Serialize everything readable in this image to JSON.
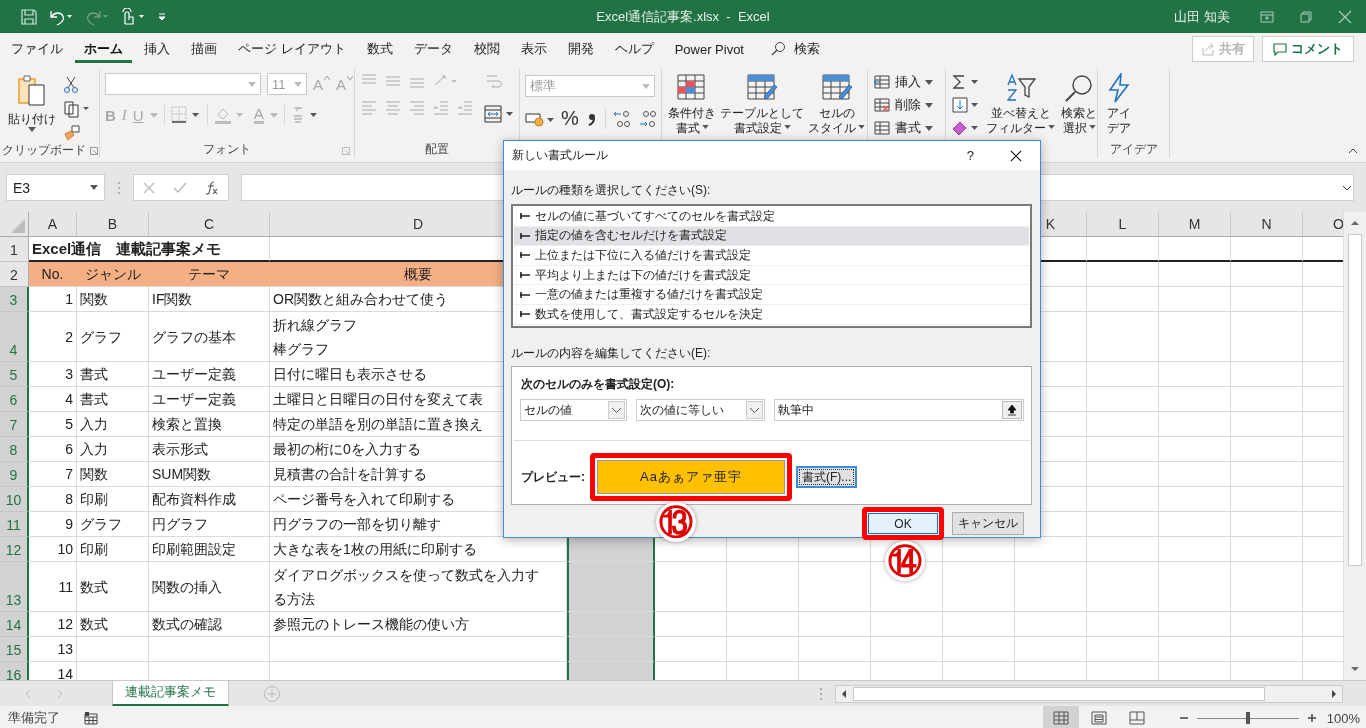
{
  "title_bar": {
    "title": "Excel通信記事案.xlsx  -  Excel",
    "user": "山田 知美"
  },
  "menu_tabs": [
    {
      "label": "ファイル",
      "selected": false
    },
    {
      "label": "ホーム",
      "selected": true
    },
    {
      "label": "挿入",
      "selected": false
    },
    {
      "label": "描画",
      "selected": false
    },
    {
      "label": "ページ レイアウト",
      "selected": false
    },
    {
      "label": "数式",
      "selected": false
    },
    {
      "label": "データ",
      "selected": false
    },
    {
      "label": "校閲",
      "selected": false
    },
    {
      "label": "表示",
      "selected": false
    },
    {
      "label": "開発",
      "selected": false
    },
    {
      "label": "ヘルプ",
      "selected": false
    },
    {
      "label": "Power Pivot",
      "selected": false
    }
  ],
  "search": {
    "label": "検索"
  },
  "share_button": {
    "label": "共有",
    "disabled": true
  },
  "comment_button": {
    "label": "コメント"
  },
  "ribbon": {
    "clipboard": {
      "paste": "貼り付け",
      "group": "クリップボード"
    },
    "font": {
      "size": "11",
      "grow": "A",
      "shrink": "A",
      "bold": "B",
      "italic": "I",
      "underline": "U",
      "font_color": "A",
      "group": "フォント"
    },
    "alignment": {
      "group": "配置"
    },
    "number": {
      "format": "標準",
      "percent": "%"
    },
    "styles": [
      {
        "lines": [
          "条件付き",
          "書式"
        ]
      },
      {
        "lines": [
          "テーブルとして",
          "書式設定"
        ]
      },
      {
        "lines": [
          "セルの",
          "スタイル"
        ]
      }
    ],
    "cells": [
      "挿入",
      "削除",
      "書式"
    ],
    "editing": [
      {
        "lines": [
          "並べ替えと",
          "フィルター"
        ]
      },
      {
        "lines": [
          "検索と",
          "選択"
        ]
      }
    ],
    "ideas": {
      "lines": [
        "アイ",
        "デア"
      ],
      "group": "アイデア"
    }
  },
  "formula_bar": {
    "name_box": "E3"
  },
  "column_headers_left": [
    "A",
    "B",
    "C",
    "D"
  ],
  "column_headers_right": [
    "K",
    "L",
    "M",
    "N",
    "O"
  ],
  "rows": [
    {
      "num": "1",
      "kind": "title",
      "selected": false,
      "cells": [
        "Excel通信　連載記事案メモ"
      ]
    },
    {
      "num": "2",
      "kind": "header",
      "selected": false,
      "cells": [
        "No.",
        "ジャンル",
        "テーマ",
        "概要"
      ]
    },
    {
      "num": "3",
      "kind": "data",
      "selected": true,
      "cells": [
        "1",
        "関数",
        "IF関数",
        "OR関数と組み合わせて使う"
      ]
    },
    {
      "num": "4",
      "kind": "data",
      "selected": true,
      "cells": [
        "2",
        "グラフ",
        "グラフの基本",
        [
          "折れ線グラフ",
          "棒グラフ"
        ]
      ]
    },
    {
      "num": "5",
      "kind": "data",
      "selected": true,
      "cells": [
        "3",
        "書式",
        "ユーザー定義",
        "日付に曜日も表示させる"
      ]
    },
    {
      "num": "6",
      "kind": "data",
      "selected": true,
      "cells": [
        "4",
        "書式",
        "ユーザー定義",
        "土曜日と日曜日の日付を変えて表"
      ]
    },
    {
      "num": "7",
      "kind": "data",
      "selected": true,
      "cells": [
        "5",
        "入力",
        "検索と置換",
        "特定の単語を別の単語に置き換え"
      ]
    },
    {
      "num": "8",
      "kind": "data",
      "selected": true,
      "cells": [
        "6",
        "入力",
        "表示形式",
        "最初の桁に0を入力する"
      ]
    },
    {
      "num": "9",
      "kind": "data",
      "selected": true,
      "cells": [
        "7",
        "関数",
        "SUM関数",
        "見積書の合計を計算する"
      ]
    },
    {
      "num": "10",
      "kind": "data",
      "selected": true,
      "cells": [
        "8",
        "印刷",
        "配布資料作成",
        "ページ番号を入れて印刷する"
      ]
    },
    {
      "num": "11",
      "kind": "data",
      "selected": true,
      "cells": [
        "9",
        "グラフ",
        "円グラフ",
        "円グラフの一部を切り離す"
      ]
    },
    {
      "num": "12",
      "kind": "data",
      "selected": true,
      "cells": [
        "10",
        "印刷",
        "印刷範囲設定",
        "大きな表を1枚の用紙に印刷する"
      ]
    },
    {
      "num": "13",
      "kind": "data",
      "selected": true,
      "cells": [
        "11",
        "数式",
        "関数の挿入",
        [
          "ダイアログボックスを使って数式を入力す",
          "る方法"
        ]
      ]
    },
    {
      "num": "14",
      "kind": "data",
      "selected": true,
      "cells": [
        "12",
        "数式",
        "数式の確認",
        "参照元のトレース機能の使い方"
      ]
    },
    {
      "num": "15",
      "kind": "data",
      "selected": true,
      "cells": [
        "13"
      ]
    },
    {
      "num": "16",
      "kind": "data",
      "selected": true,
      "cells": [
        "14"
      ]
    }
  ],
  "dialog": {
    "title": "新しい書式ルール",
    "help": "?",
    "rule_type_label": "ルールの種類を選択してください(S):",
    "rule_types": [
      {
        "label": "セルの値に基づいてすべてのセルを書式設定",
        "selected": false
      },
      {
        "label": "指定の値を含むセルだけを書式設定",
        "selected": true
      },
      {
        "label": "上位または下位に入る値だけを書式設定",
        "selected": false
      },
      {
        "label": "平均より上または下の値だけを書式設定",
        "selected": false
      },
      {
        "label": "一意の値または重複する値だけを書式設定",
        "selected": false
      },
      {
        "label": "数式を使用して、書式設定するセルを決定",
        "selected": false
      }
    ],
    "edit_label": "ルールの内容を編集してください(E):",
    "condition_label": "次のセルのみを書式設定(O):",
    "operand": "セルの値",
    "operator": "次の値に等しい",
    "value": "執筆中",
    "preview_label": "プレビュー:",
    "preview_text": "Aaあぁアァ亜宇",
    "format_button": "書式(F)...",
    "ok": "OK",
    "cancel": "キャンセル"
  },
  "annotations": [
    "⑬",
    "⑭"
  ],
  "sheet_tabs": [
    {
      "label": "連載記事案メモ",
      "selected": true
    }
  ],
  "status_bar": {
    "status": "準備完了",
    "zoom": {
      "level": 0.5,
      "reading": "100%"
    }
  }
}
